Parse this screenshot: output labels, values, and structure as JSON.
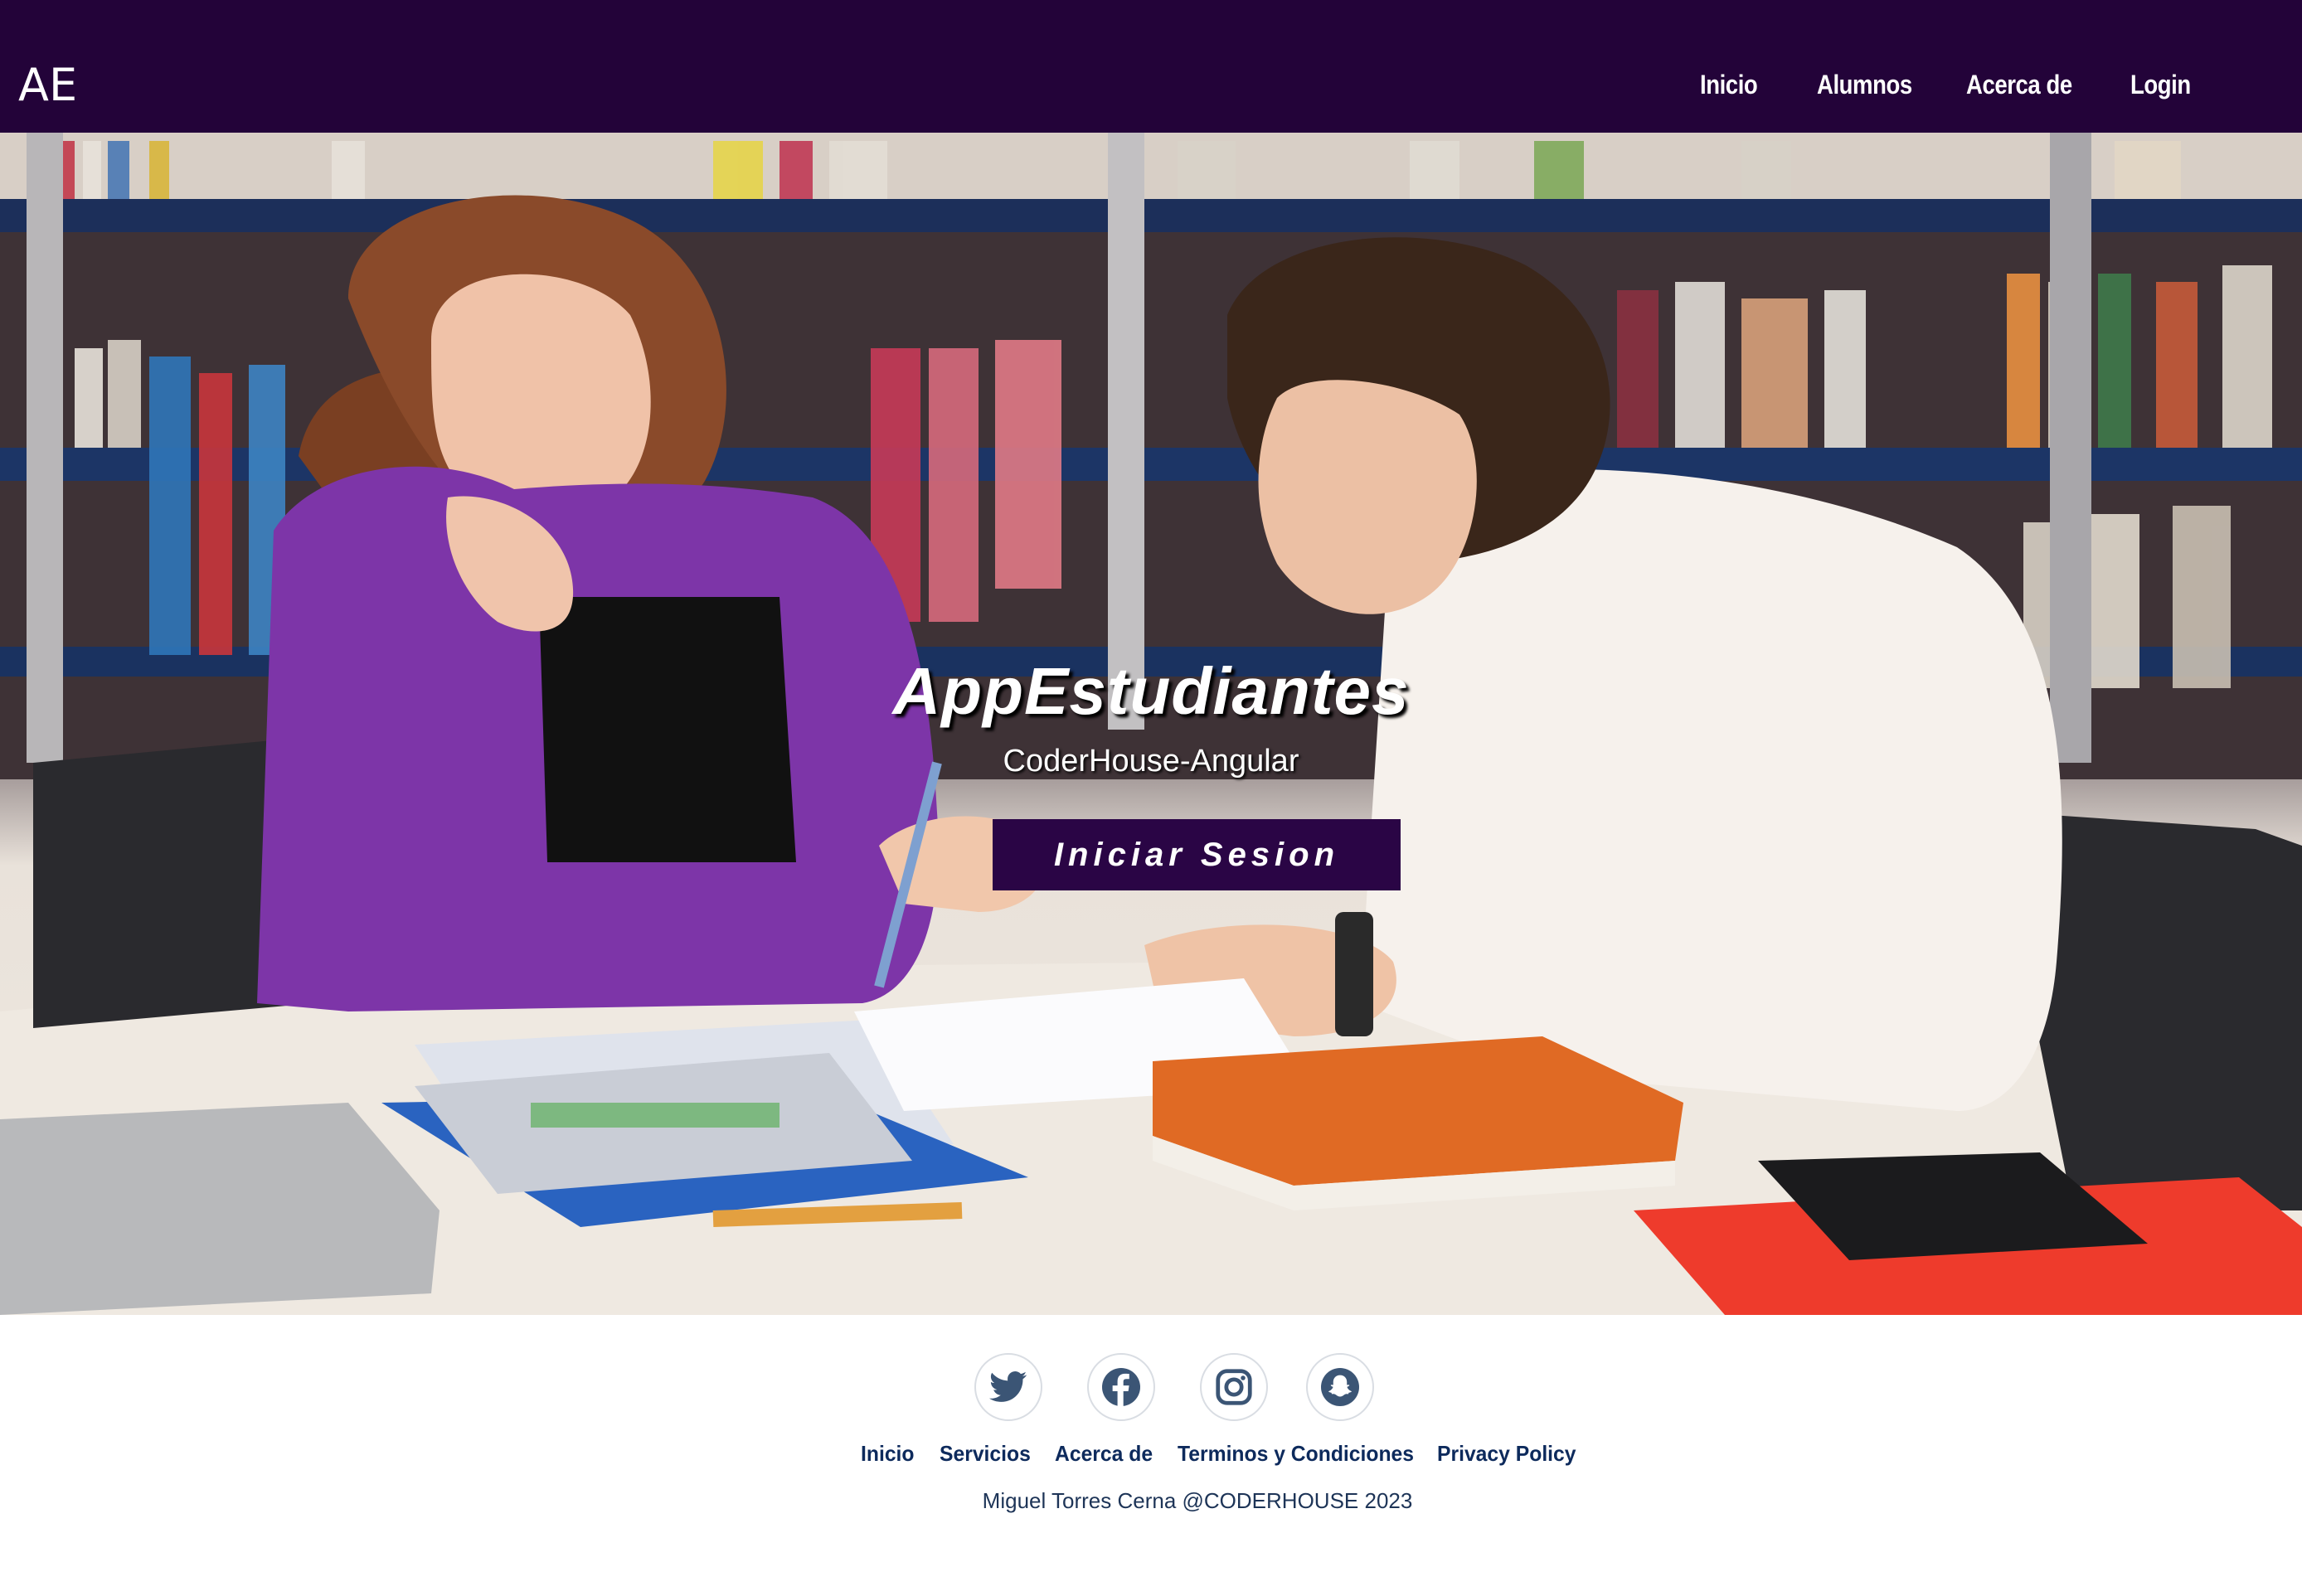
{
  "navbar": {
    "brand": "AE",
    "links": [
      {
        "label": "Inicio"
      },
      {
        "label": "Alumnos"
      },
      {
        "label": "Acerca de"
      },
      {
        "label": "Login"
      }
    ],
    "background": "#230339"
  },
  "hero": {
    "title": "AppEstudiantes",
    "subtitle": "CoderHouse-Angular",
    "button_label": "Iniciar Sesion",
    "button_color": "#2a0545"
  },
  "footer": {
    "social_icons": [
      "twitter-icon",
      "facebook-icon",
      "instagram-icon",
      "snapchat-icon"
    ],
    "links": [
      {
        "label": "Inicio"
      },
      {
        "label": "Servicios"
      },
      {
        "label": "Acerca de"
      },
      {
        "label": "Terminos y Condiciones"
      },
      {
        "label": "Privacy Policy"
      }
    ],
    "copyright": "Miguel Torres Cerna @CODERHOUSE 2023",
    "link_color": "#0d2a5c"
  }
}
